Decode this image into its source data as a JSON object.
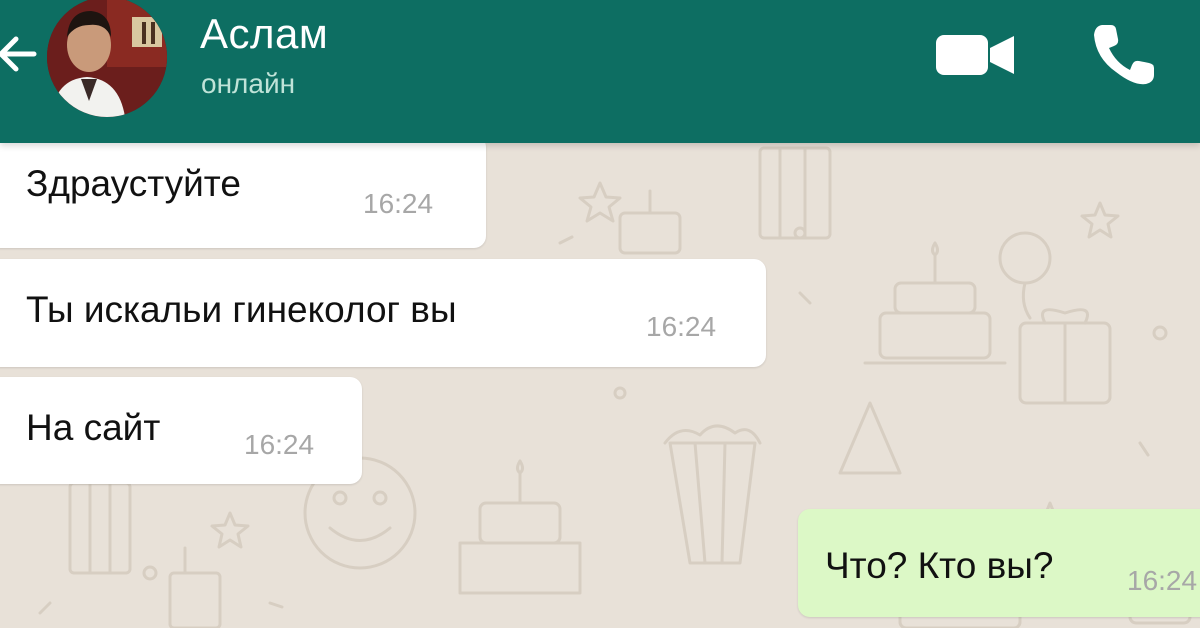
{
  "header": {
    "contact_name": "Аслам",
    "status": "онлайн",
    "back_icon": "arrow-left-icon",
    "video_icon": "video-camera-icon",
    "call_icon": "phone-icon",
    "color": "#0d6e62"
  },
  "messages": [
    {
      "direction": "incoming",
      "text": "Здраустуйте",
      "time": "16:24"
    },
    {
      "direction": "incoming",
      "text": "Ты искальи гинеколог вы",
      "time": "16:24"
    },
    {
      "direction": "incoming",
      "text": "На сайт",
      "time": "16:24"
    },
    {
      "direction": "outgoing",
      "text": "Что? Кто вы?",
      "time": "16:24"
    }
  ],
  "colors": {
    "incoming_bubble": "#ffffff",
    "outgoing_bubble": "#dcf8c6",
    "chat_background": "#e8e1d8"
  }
}
